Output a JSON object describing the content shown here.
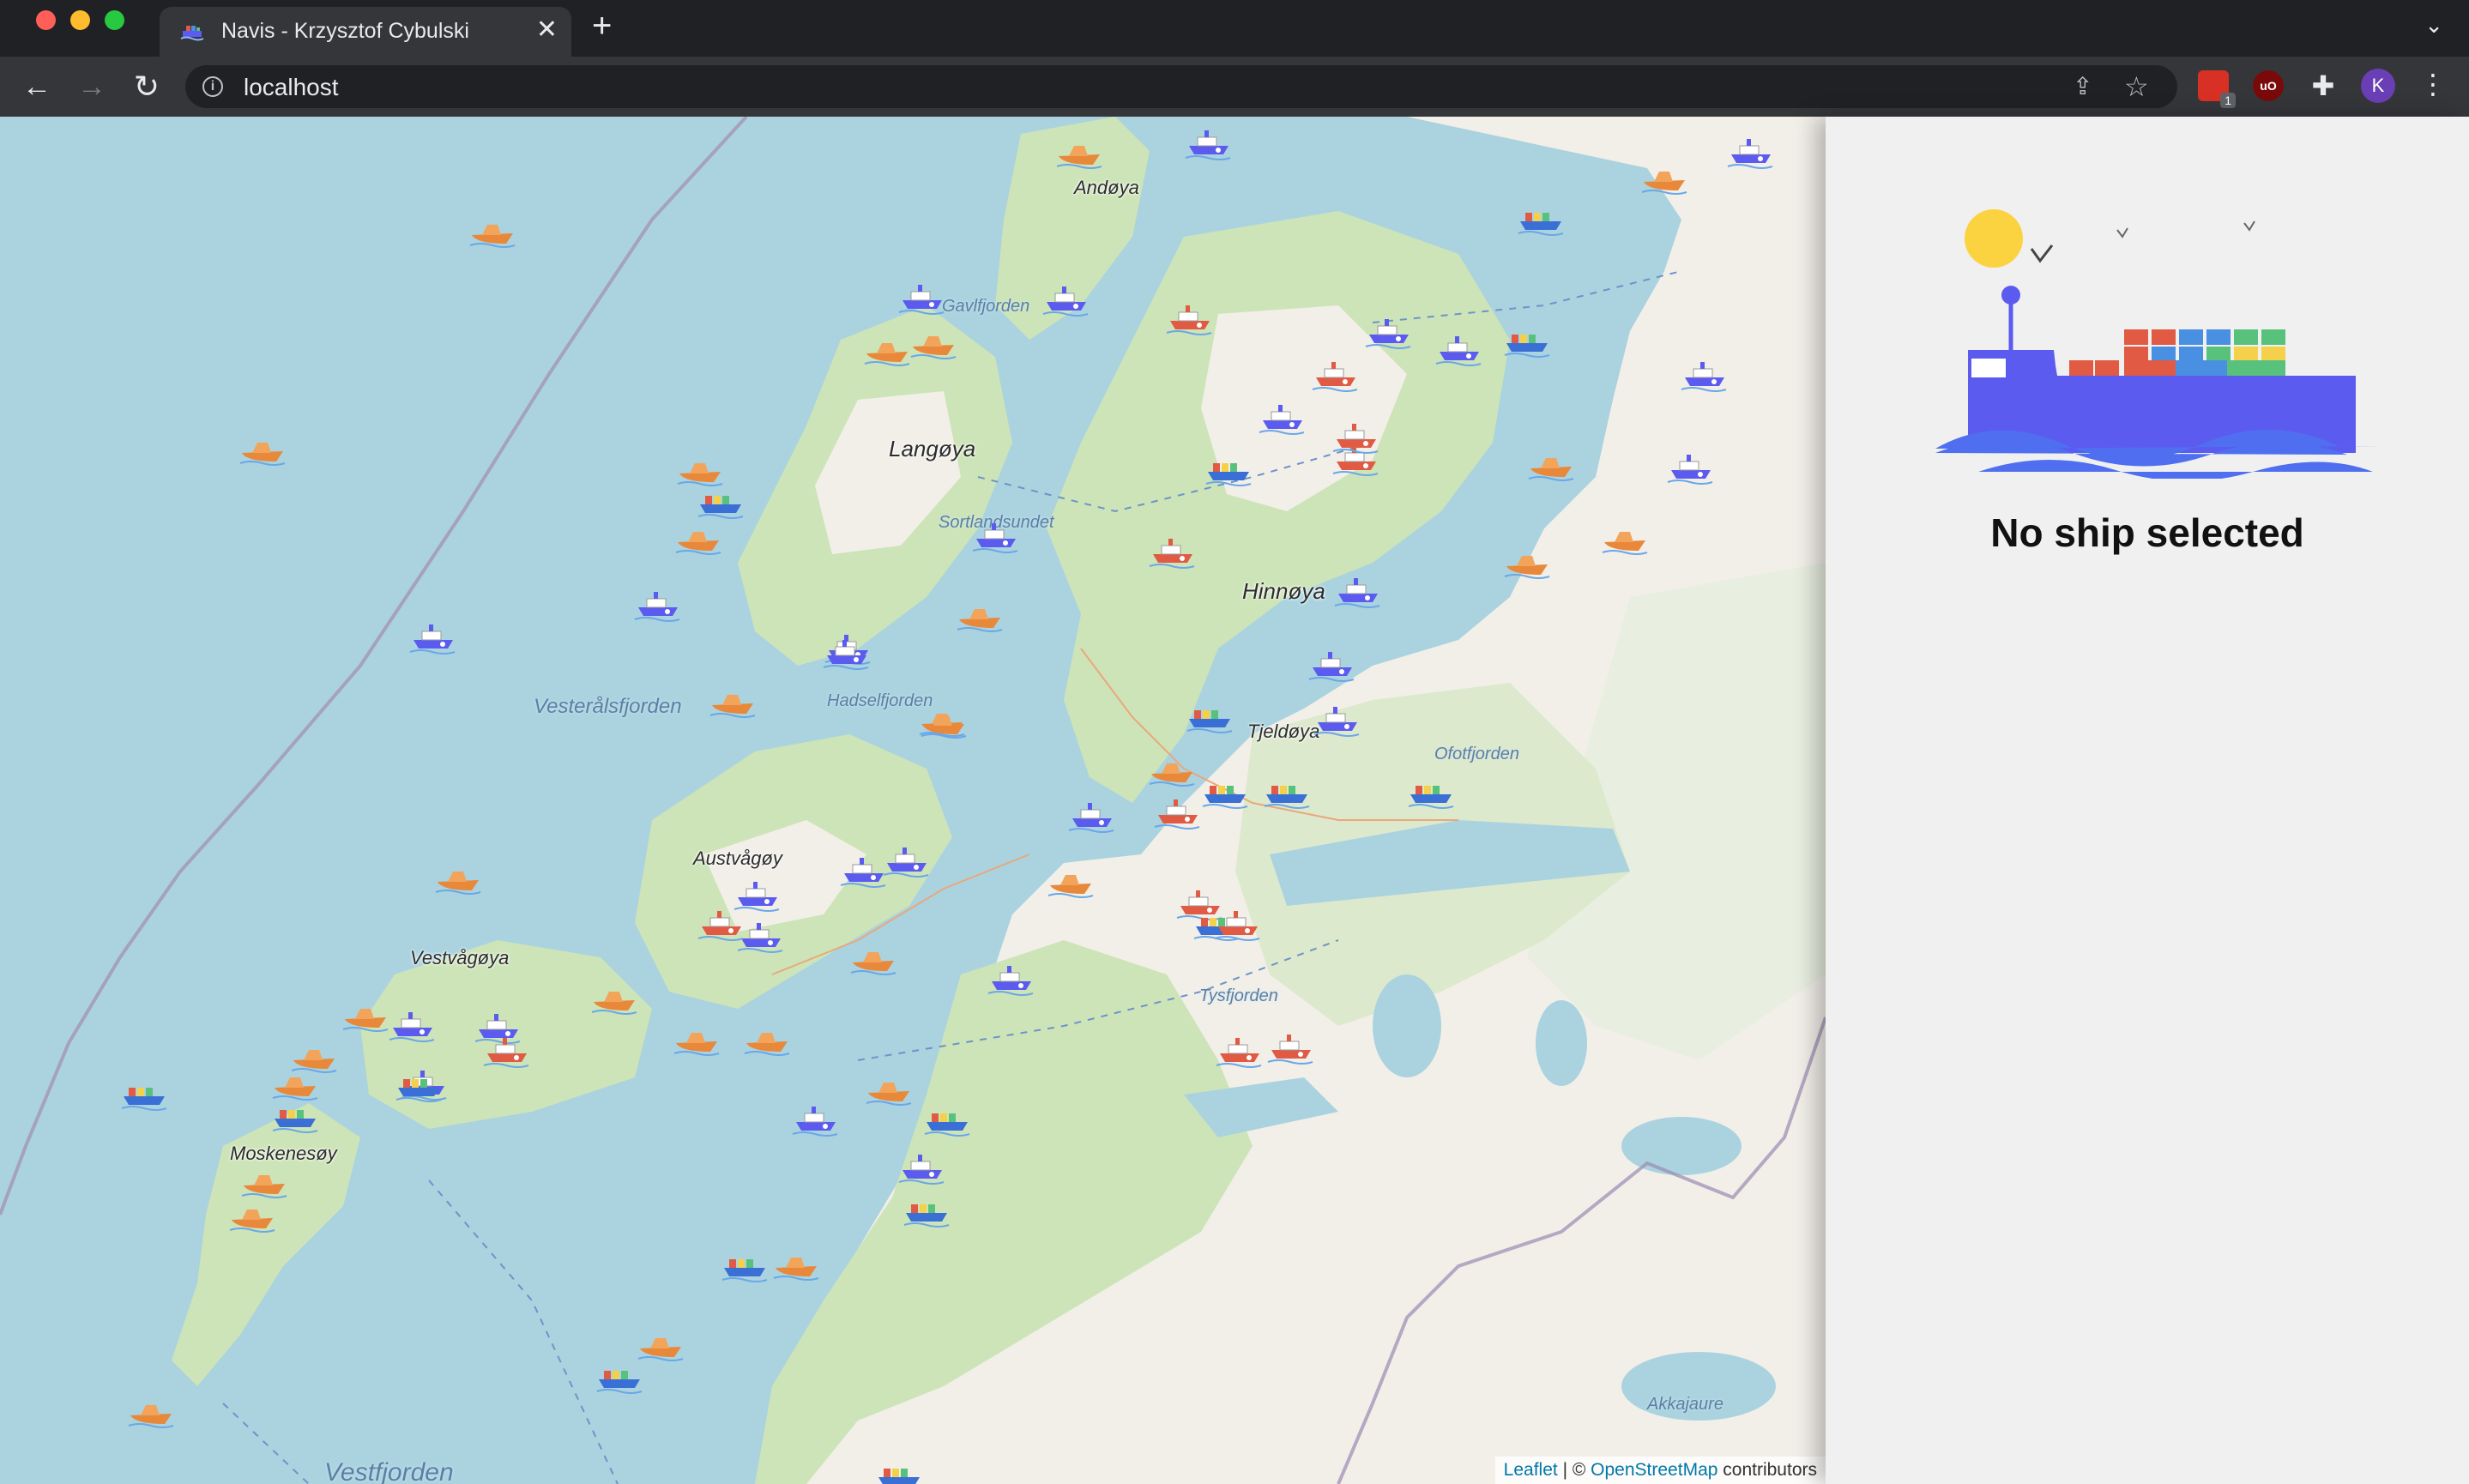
{
  "browser": {
    "tab": {
      "title": "Navis - Krzysztof Cybulski",
      "close": "✕",
      "favicon": "ship-icon"
    },
    "new_tab": "+",
    "tab_overflow": "⌄",
    "address": {
      "url": "localhost",
      "info": "i"
    },
    "nav": {
      "back": "←",
      "forward": "→",
      "reload": "↻"
    },
    "actions": {
      "share": "⇪",
      "bookmark": "☆"
    },
    "extensions": {
      "badge": "1",
      "ublock": "uO",
      "puzzle": "✚"
    },
    "avatar": "K",
    "menu": "⋮"
  },
  "map": {
    "places": [
      {
        "name": "Andøya"
      },
      {
        "name": "Langøya"
      },
      {
        "name": "Hinnøya"
      },
      {
        "name": "Tjeldøya"
      },
      {
        "name": "Austvågøy"
      },
      {
        "name": "Vestvågøya"
      },
      {
        "name": "Moskenesøy"
      },
      {
        "name": "Sortlandsundet"
      },
      {
        "name": "Hadselfjorden"
      },
      {
        "name": "Ofotfjorden"
      },
      {
        "name": "Tysfjorden"
      },
      {
        "name": "Akkajaure"
      },
      {
        "name": "Vesterålsfjorden"
      },
      {
        "name": "Vestfjorden"
      },
      {
        "name": "Gavlfjorden"
      }
    ],
    "attribution": {
      "leaflet": "Leaflet",
      "separator": " | © ",
      "osm": "OpenStreetMap",
      "suffix": " contributors"
    }
  },
  "panel": {
    "message": "No ship selected",
    "illustration": "container-ship-illustration"
  },
  "colors": {
    "water": "#aad3df",
    "land": "#f2efe9",
    "forest": "#cde4b8",
    "panel_bg": "#f0f0f0",
    "ship_hull": "#5b5bf0",
    "sun": "#fbd341"
  }
}
